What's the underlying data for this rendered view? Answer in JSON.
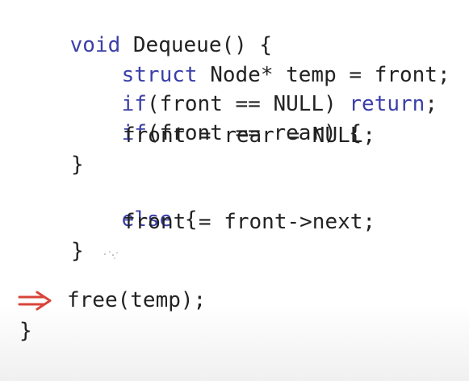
{
  "code": {
    "lines": {
      "l1_kw": "void",
      "l1_rest": " Dequeue() {",
      "l2_kw": "struct",
      "l2_rest": " Node* temp = front;",
      "l3_kw1": "if",
      "l3_mid": "(front == NULL) ",
      "l3_kw2": "return",
      "l3_end": ";",
      "l4_kw": "if",
      "l4_rest": "(front == rear) {",
      "l5": "front = rear = NULL;",
      "l6": "}",
      "l7_kw": "else",
      "l7_rest": " {",
      "l8": "front = front->next;",
      "l9": "}",
      "l10": "free(temp);",
      "l11": "}"
    }
  },
  "annotation": {
    "arrow_icon": "double-right-arrow-icon",
    "arrow_color": "#d9453a"
  },
  "colors": {
    "keyword": "#3b3fa8",
    "text": "#222222",
    "background": "#ffffff"
  }
}
